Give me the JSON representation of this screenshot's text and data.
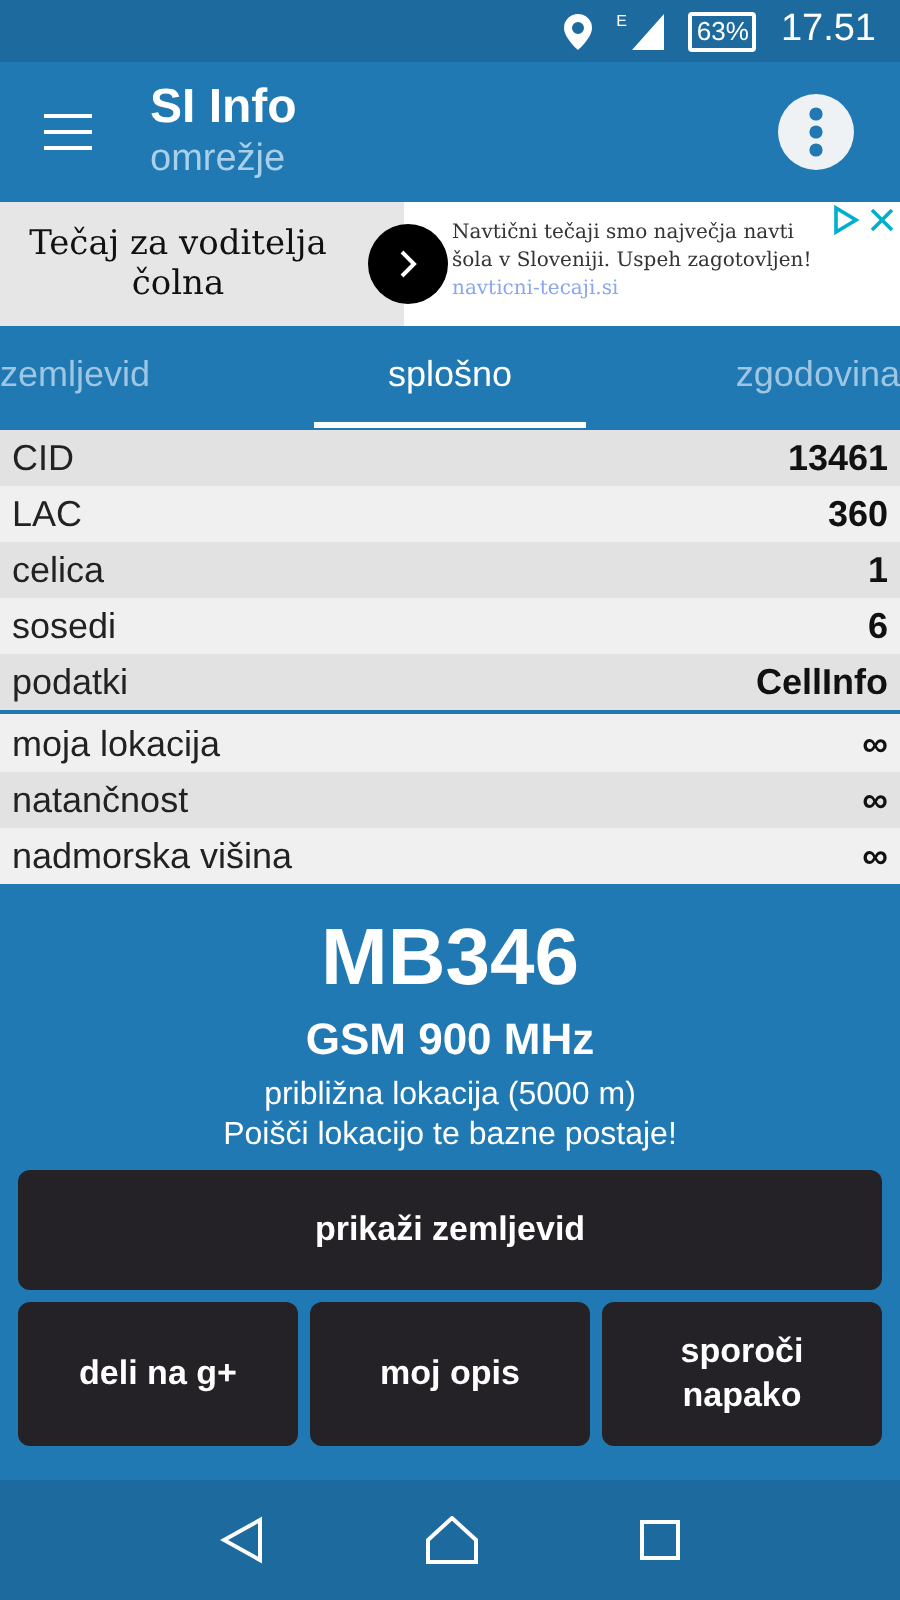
{
  "status_bar": {
    "battery": "63%",
    "time": "17.51",
    "network": "E"
  },
  "app_bar": {
    "title": "SI Info",
    "subtitle": "omrežje"
  },
  "ad": {
    "headline": "Tečaj za voditelja čolna",
    "body": "Navtični tečaji smo največja navti",
    "body_2": "šola v Sloveniji. Uspeh zagotovljen!",
    "url": "navticni-tecaji.si"
  },
  "tabs": [
    {
      "label": "zemljevid",
      "selected": false
    },
    {
      "label": "splošno",
      "selected": true
    },
    {
      "label": "zgodovina",
      "selected": false
    }
  ],
  "cell_rows": [
    {
      "label": "CID",
      "value": "13461"
    },
    {
      "label": "LAC",
      "value": "360"
    },
    {
      "label": "celica",
      "value": "1"
    },
    {
      "label": "sosedi",
      "value": "6"
    },
    {
      "label": "podatki",
      "value": "CellInfo"
    }
  ],
  "location_rows": [
    {
      "label": "moja lokacija",
      "value": "∞"
    },
    {
      "label": "natančnost",
      "value": "∞"
    },
    {
      "label": "nadmorska višina",
      "value": "∞"
    }
  ],
  "station": {
    "name": "MB346",
    "band": "GSM 900 MHz",
    "note": "približna lokacija (5000 m)",
    "hint": "Poišči lokacijo te bazne postaje!"
  },
  "buttons": [
    {
      "label": "prikaži zemljevid",
      "kind": "wide"
    },
    {
      "label": "deli na g+",
      "kind": "small"
    },
    {
      "label": "moj opis",
      "kind": "small"
    },
    {
      "label": "sporoči napako",
      "kind": "small"
    }
  ]
}
